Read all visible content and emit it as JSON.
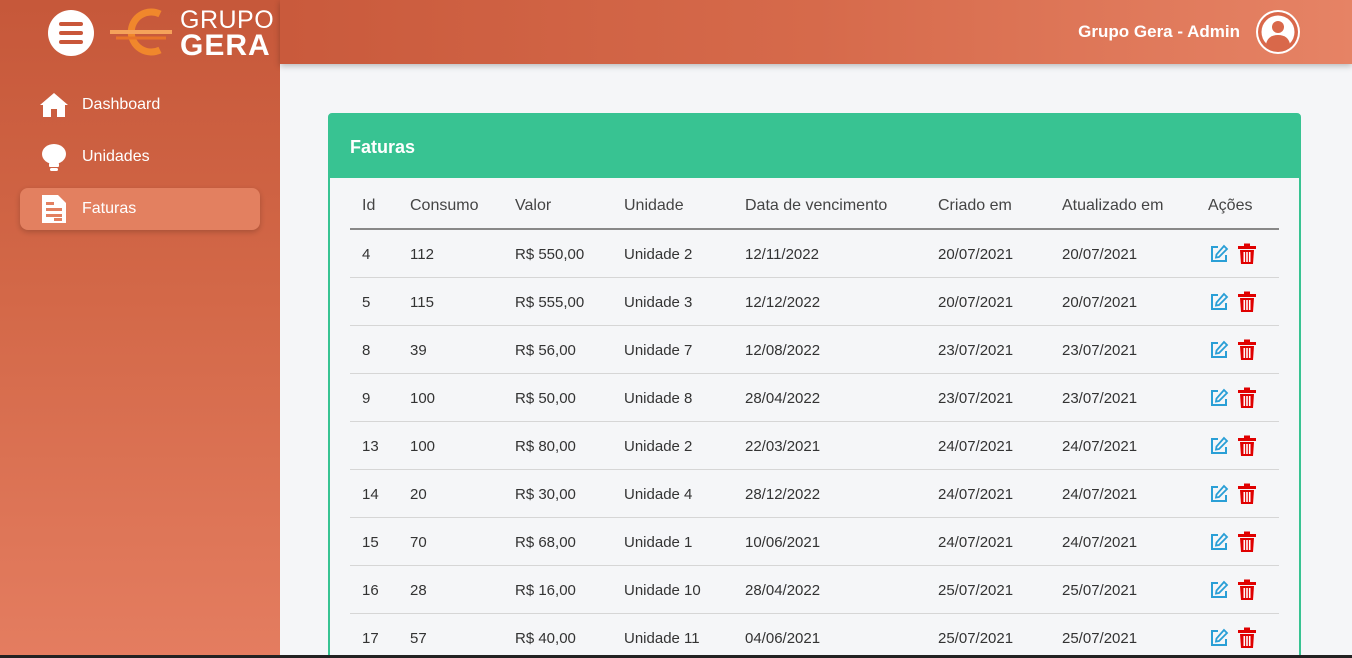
{
  "brand": {
    "line1": "GRUPO",
    "line2": "GERA"
  },
  "header": {
    "user_name": "Grupo Gera - Admin"
  },
  "sidebar": {
    "items": [
      {
        "label": "Dashboard",
        "icon": "home-icon",
        "active": false
      },
      {
        "label": "Unidades",
        "icon": "lightbulb-icon",
        "active": false
      },
      {
        "label": "Faturas",
        "icon": "invoice-icon",
        "active": true
      }
    ]
  },
  "card": {
    "title": "Faturas",
    "columns": [
      "Id",
      "Consumo",
      "Valor",
      "Unidade",
      "Data de vencimento",
      "Criado em",
      "Atualizado em",
      "Ações"
    ],
    "rows": [
      [
        "4",
        "112",
        "R$ 550,00",
        "Unidade 2",
        "12/11/2022",
        "20/07/2021",
        "20/07/2021"
      ],
      [
        "5",
        "115",
        "R$ 555,00",
        "Unidade 3",
        "12/12/2022",
        "20/07/2021",
        "20/07/2021"
      ],
      [
        "8",
        "39",
        "R$ 56,00",
        "Unidade 7",
        "12/08/2022",
        "23/07/2021",
        "23/07/2021"
      ],
      [
        "9",
        "100",
        "R$ 50,00",
        "Unidade 8",
        "28/04/2022",
        "23/07/2021",
        "23/07/2021"
      ],
      [
        "13",
        "100",
        "R$ 80,00",
        "Unidade 2",
        "22/03/2021",
        "24/07/2021",
        "24/07/2021"
      ],
      [
        "14",
        "20",
        "R$ 30,00",
        "Unidade 4",
        "28/12/2022",
        "24/07/2021",
        "24/07/2021"
      ],
      [
        "15",
        "70",
        "R$ 68,00",
        "Unidade 1",
        "10/06/2021",
        "24/07/2021",
        "24/07/2021"
      ],
      [
        "16",
        "28",
        "R$ 16,00",
        "Unidade 10",
        "28/04/2022",
        "25/07/2021",
        "25/07/2021"
      ],
      [
        "17",
        "57",
        "R$ 40,00",
        "Unidade 11",
        "04/06/2021",
        "25/07/2021",
        "25/07/2021"
      ]
    ]
  },
  "colors": {
    "sidebar_top": "#c6583a",
    "sidebar_bottom": "#e47d60",
    "card_accent": "#38c392",
    "edit_icon": "#2a9fd6",
    "delete_icon": "#e00000"
  }
}
